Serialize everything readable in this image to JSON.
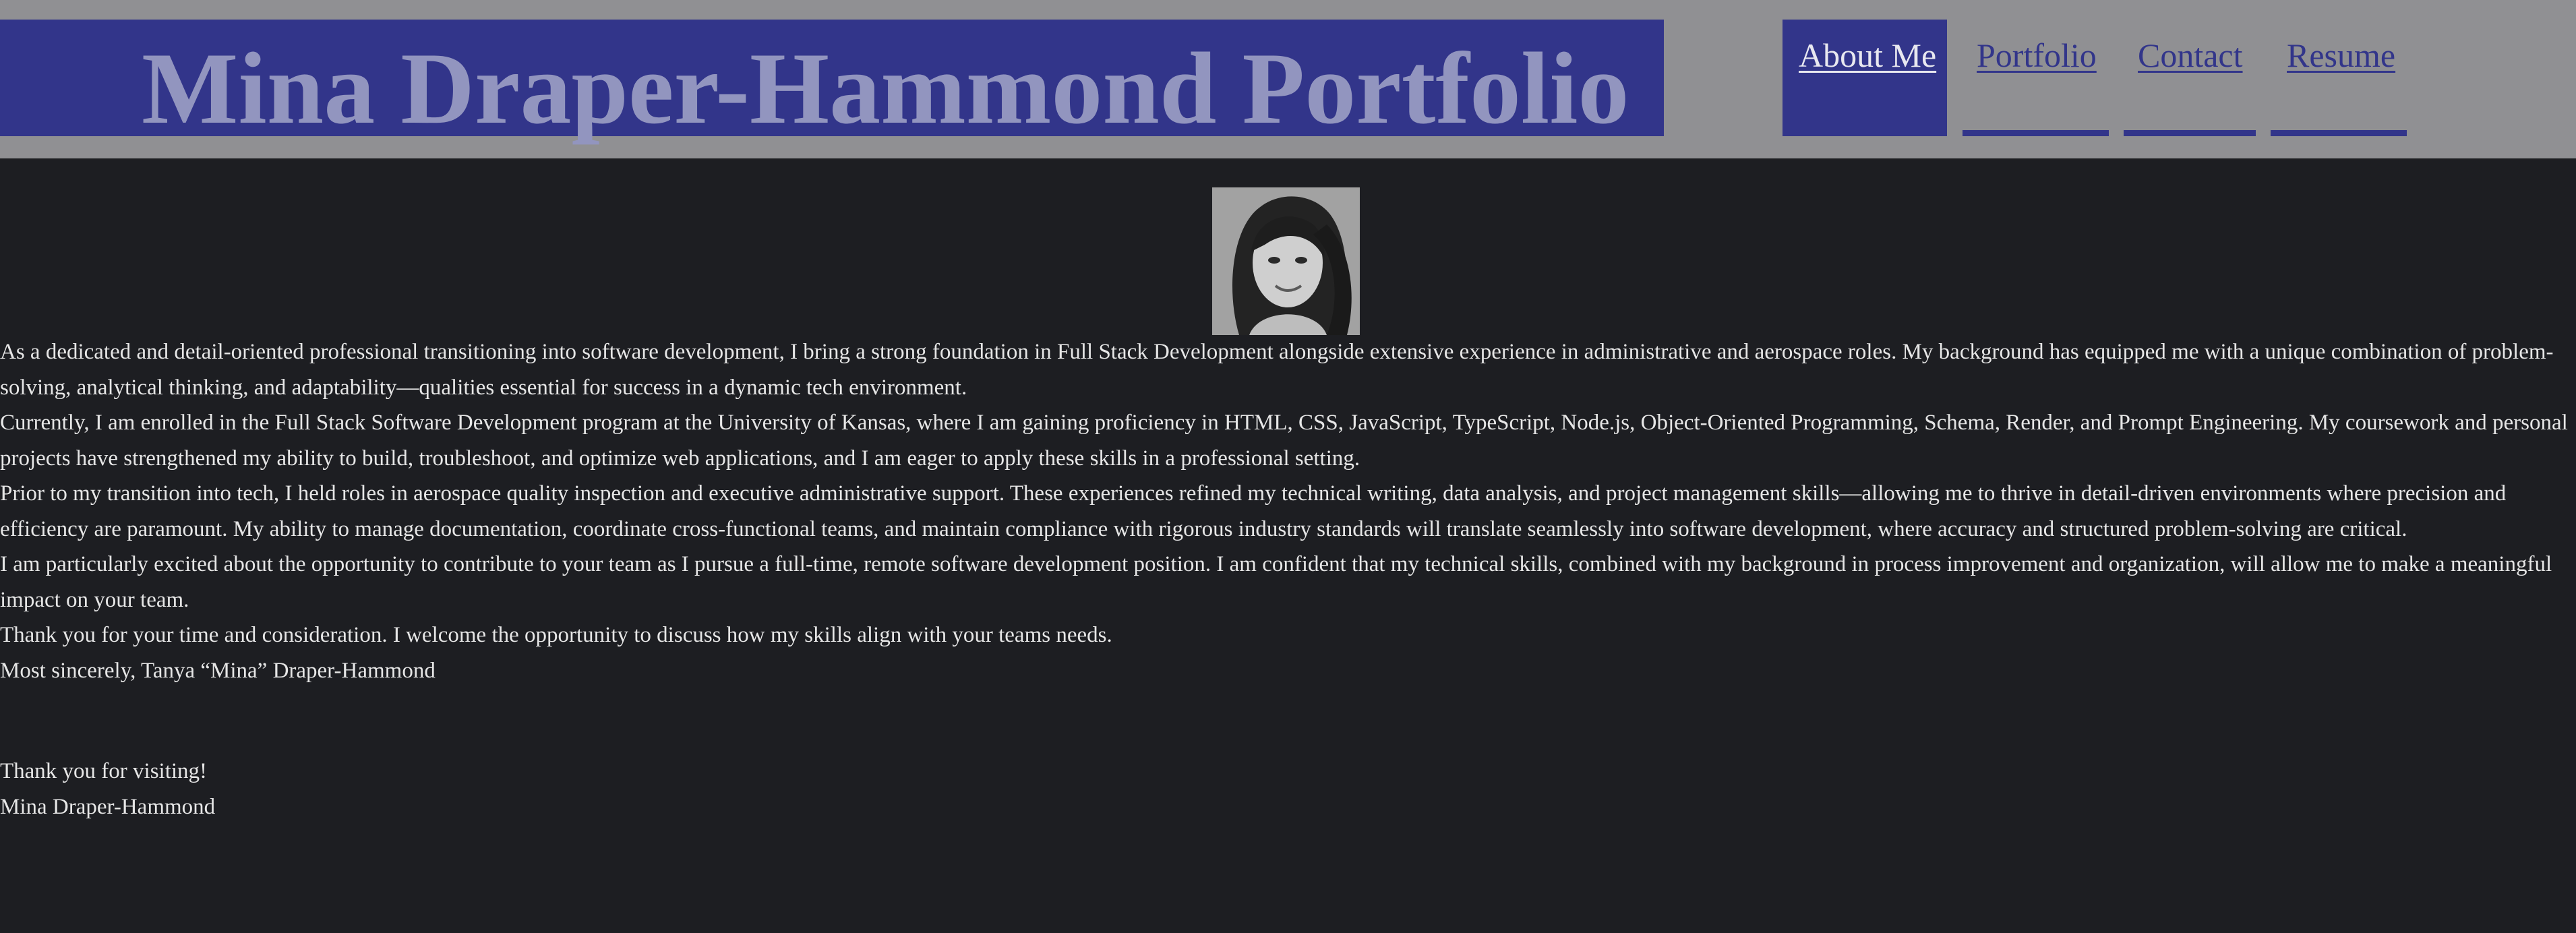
{
  "header": {
    "title": "Mina Draper-Hammond Portfolio"
  },
  "nav": {
    "items": [
      {
        "label": "About Me",
        "active": true
      },
      {
        "label": "Portfolio",
        "active": false
      },
      {
        "label": "Contact",
        "active": false
      },
      {
        "label": "Resume",
        "active": false
      }
    ]
  },
  "colors": {
    "header_bg": "#909093",
    "accent": "#32358a",
    "title_text": "#9295bf",
    "nav_link": "#32358a",
    "nav_active_link": "#e8e8f0",
    "page_bg": "#1d1e22",
    "body_text": "#e6e6e6"
  },
  "profile": {
    "photo_icon": "profile-photo"
  },
  "about": {
    "paragraphs": [
      "As a dedicated and detail-oriented professional transitioning into software development, I bring a strong foundation in Full Stack Development alongside extensive experience in administrative and aerospace roles. My background has equipped me with a unique combination of problem-solving, analytical thinking, and adaptability—qualities essential for success in a dynamic tech environment.",
      "Currently, I am enrolled in the Full Stack Software Development program at the University of Kansas, where I am gaining proficiency in HTML, CSS, JavaScript, TypeScript, Node.js, Object-Oriented Programming, Schema, Render, and Prompt Engineering. My coursework and personal projects have strengthened my ability to build, troubleshoot, and optimize web applications, and I am eager to apply these skills in a professional setting.",
      "Prior to my transition into tech, I held roles in aerospace quality inspection and executive administrative support. These experiences refined my technical writing, data analysis, and project management skills—allowing me to thrive in detail-driven environments where precision and efficiency are paramount. My ability to manage documentation, coordinate cross-functional teams, and maintain compliance with rigorous industry standards will translate seamlessly into software development, where accuracy and structured problem-solving are critical.",
      "I am particularly excited about the opportunity to contribute to your team as I pursue a full-time, remote software development position. I am confident that my technical skills, combined with my background in process improvement and organization, will allow me to make a meaningful impact on your team.",
      "Thank you for your time and consideration. I welcome the opportunity to discuss how my skills align with your teams needs.",
      "Most sincerely, Tanya “Mina” Draper-Hammond"
    ],
    "closing": "Thank you for visiting!",
    "signature": "Mina Draper-Hammond"
  }
}
